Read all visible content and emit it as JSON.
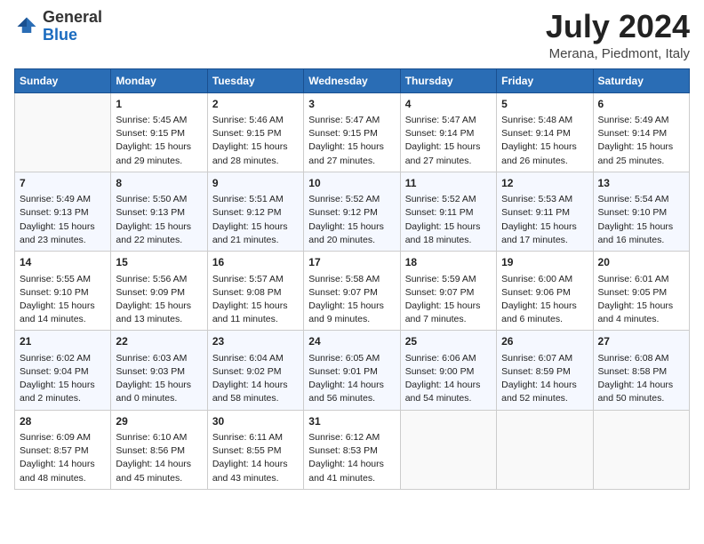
{
  "header": {
    "logo_general": "General",
    "logo_blue": "Blue",
    "month_year": "July 2024",
    "location": "Merana, Piedmont, Italy"
  },
  "days_of_week": [
    "Sunday",
    "Monday",
    "Tuesday",
    "Wednesday",
    "Thursday",
    "Friday",
    "Saturday"
  ],
  "weeks": [
    [
      {
        "num": "",
        "info": ""
      },
      {
        "num": "1",
        "info": "Sunrise: 5:45 AM\nSunset: 9:15 PM\nDaylight: 15 hours\nand 29 minutes."
      },
      {
        "num": "2",
        "info": "Sunrise: 5:46 AM\nSunset: 9:15 PM\nDaylight: 15 hours\nand 28 minutes."
      },
      {
        "num": "3",
        "info": "Sunrise: 5:47 AM\nSunset: 9:15 PM\nDaylight: 15 hours\nand 27 minutes."
      },
      {
        "num": "4",
        "info": "Sunrise: 5:47 AM\nSunset: 9:14 PM\nDaylight: 15 hours\nand 27 minutes."
      },
      {
        "num": "5",
        "info": "Sunrise: 5:48 AM\nSunset: 9:14 PM\nDaylight: 15 hours\nand 26 minutes."
      },
      {
        "num": "6",
        "info": "Sunrise: 5:49 AM\nSunset: 9:14 PM\nDaylight: 15 hours\nand 25 minutes."
      }
    ],
    [
      {
        "num": "7",
        "info": "Sunrise: 5:49 AM\nSunset: 9:13 PM\nDaylight: 15 hours\nand 23 minutes."
      },
      {
        "num": "8",
        "info": "Sunrise: 5:50 AM\nSunset: 9:13 PM\nDaylight: 15 hours\nand 22 minutes."
      },
      {
        "num": "9",
        "info": "Sunrise: 5:51 AM\nSunset: 9:12 PM\nDaylight: 15 hours\nand 21 minutes."
      },
      {
        "num": "10",
        "info": "Sunrise: 5:52 AM\nSunset: 9:12 PM\nDaylight: 15 hours\nand 20 minutes."
      },
      {
        "num": "11",
        "info": "Sunrise: 5:52 AM\nSunset: 9:11 PM\nDaylight: 15 hours\nand 18 minutes."
      },
      {
        "num": "12",
        "info": "Sunrise: 5:53 AM\nSunset: 9:11 PM\nDaylight: 15 hours\nand 17 minutes."
      },
      {
        "num": "13",
        "info": "Sunrise: 5:54 AM\nSunset: 9:10 PM\nDaylight: 15 hours\nand 16 minutes."
      }
    ],
    [
      {
        "num": "14",
        "info": "Sunrise: 5:55 AM\nSunset: 9:10 PM\nDaylight: 15 hours\nand 14 minutes."
      },
      {
        "num": "15",
        "info": "Sunrise: 5:56 AM\nSunset: 9:09 PM\nDaylight: 15 hours\nand 13 minutes."
      },
      {
        "num": "16",
        "info": "Sunrise: 5:57 AM\nSunset: 9:08 PM\nDaylight: 15 hours\nand 11 minutes."
      },
      {
        "num": "17",
        "info": "Sunrise: 5:58 AM\nSunset: 9:07 PM\nDaylight: 15 hours\nand 9 minutes."
      },
      {
        "num": "18",
        "info": "Sunrise: 5:59 AM\nSunset: 9:07 PM\nDaylight: 15 hours\nand 7 minutes."
      },
      {
        "num": "19",
        "info": "Sunrise: 6:00 AM\nSunset: 9:06 PM\nDaylight: 15 hours\nand 6 minutes."
      },
      {
        "num": "20",
        "info": "Sunrise: 6:01 AM\nSunset: 9:05 PM\nDaylight: 15 hours\nand 4 minutes."
      }
    ],
    [
      {
        "num": "21",
        "info": "Sunrise: 6:02 AM\nSunset: 9:04 PM\nDaylight: 15 hours\nand 2 minutes."
      },
      {
        "num": "22",
        "info": "Sunrise: 6:03 AM\nSunset: 9:03 PM\nDaylight: 15 hours\nand 0 minutes."
      },
      {
        "num": "23",
        "info": "Sunrise: 6:04 AM\nSunset: 9:02 PM\nDaylight: 14 hours\nand 58 minutes."
      },
      {
        "num": "24",
        "info": "Sunrise: 6:05 AM\nSunset: 9:01 PM\nDaylight: 14 hours\nand 56 minutes."
      },
      {
        "num": "25",
        "info": "Sunrise: 6:06 AM\nSunset: 9:00 PM\nDaylight: 14 hours\nand 54 minutes."
      },
      {
        "num": "26",
        "info": "Sunrise: 6:07 AM\nSunset: 8:59 PM\nDaylight: 14 hours\nand 52 minutes."
      },
      {
        "num": "27",
        "info": "Sunrise: 6:08 AM\nSunset: 8:58 PM\nDaylight: 14 hours\nand 50 minutes."
      }
    ],
    [
      {
        "num": "28",
        "info": "Sunrise: 6:09 AM\nSunset: 8:57 PM\nDaylight: 14 hours\nand 48 minutes."
      },
      {
        "num": "29",
        "info": "Sunrise: 6:10 AM\nSunset: 8:56 PM\nDaylight: 14 hours\nand 45 minutes."
      },
      {
        "num": "30",
        "info": "Sunrise: 6:11 AM\nSunset: 8:55 PM\nDaylight: 14 hours\nand 43 minutes."
      },
      {
        "num": "31",
        "info": "Sunrise: 6:12 AM\nSunset: 8:53 PM\nDaylight: 14 hours\nand 41 minutes."
      },
      {
        "num": "",
        "info": ""
      },
      {
        "num": "",
        "info": ""
      },
      {
        "num": "",
        "info": ""
      }
    ]
  ]
}
